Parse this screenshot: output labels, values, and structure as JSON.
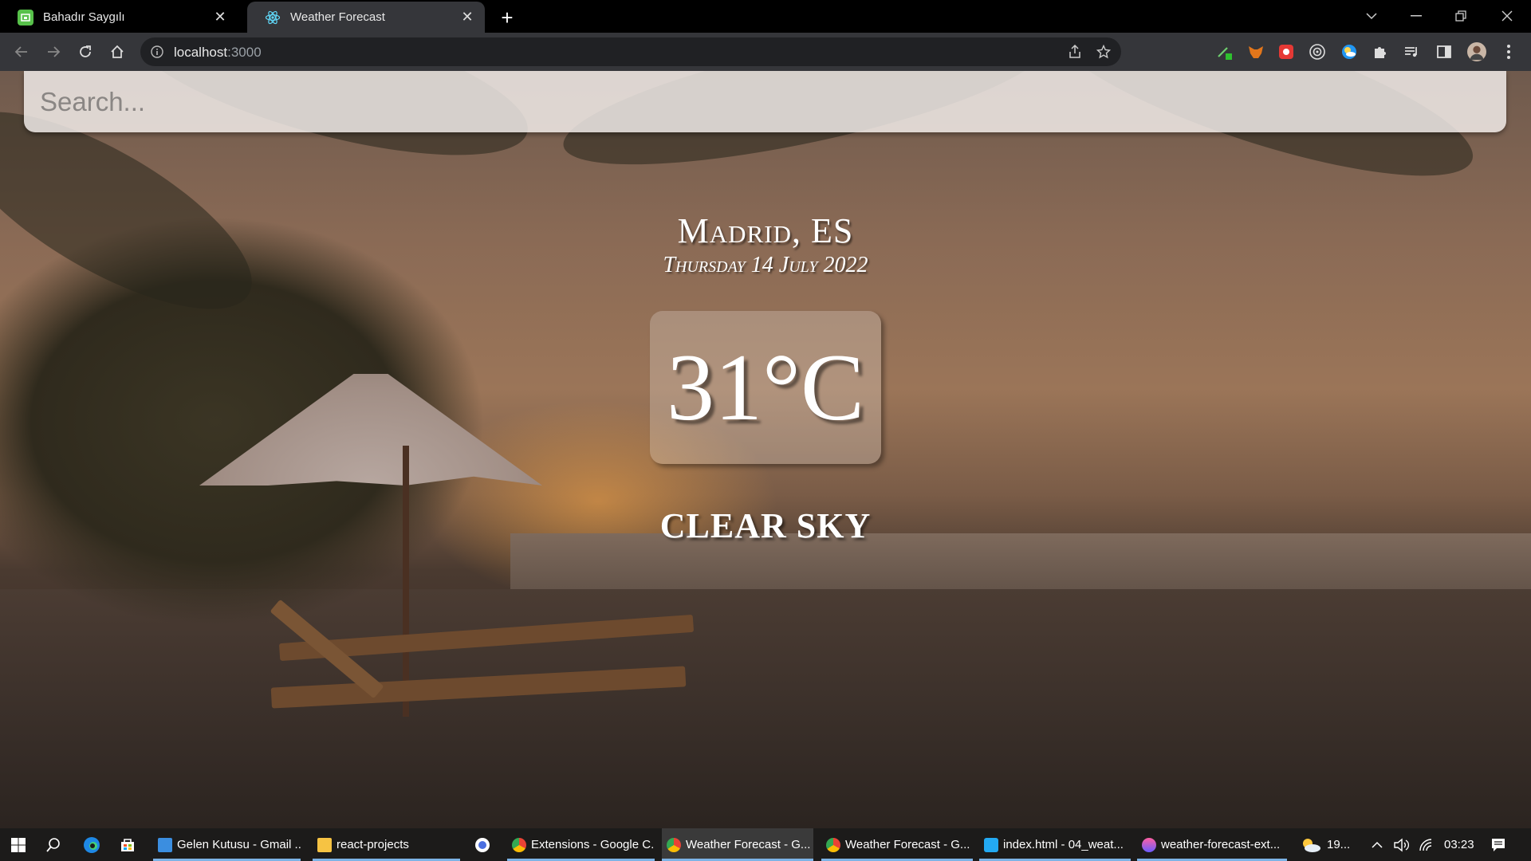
{
  "tabs": [
    {
      "label": "Bahadır Saygılı",
      "favicon": "green-badge-icon"
    },
    {
      "label": "Weather Forecast",
      "favicon": "react-atom-icon"
    }
  ],
  "address_bar": {
    "host": "localhost",
    "port": ":3000"
  },
  "search": {
    "placeholder": "Search..."
  },
  "weather": {
    "city": "Madrid, ES",
    "date": "Thursday 14 July 2022",
    "temperature": "31°C",
    "description": "CLEAR SKY"
  },
  "taskbar": {
    "apps": [
      {
        "label": "Gelen Kutusu - Gmail ..."
      },
      {
        "label": "react-projects"
      },
      {
        "label": "Extensions - Google C..."
      },
      {
        "label": "Weather Forecast - G..."
      },
      {
        "label": "Weather Forecast - G..."
      },
      {
        "label": "index.html - 04_weat..."
      },
      {
        "label": "weather-forecast-ext..."
      }
    ],
    "weather_tray": "19...",
    "clock": "03:23"
  },
  "colors": {
    "tab_active": "#35363a",
    "taskbar": "#1c1b1a",
    "accent_underline": "#7cb3e6"
  }
}
